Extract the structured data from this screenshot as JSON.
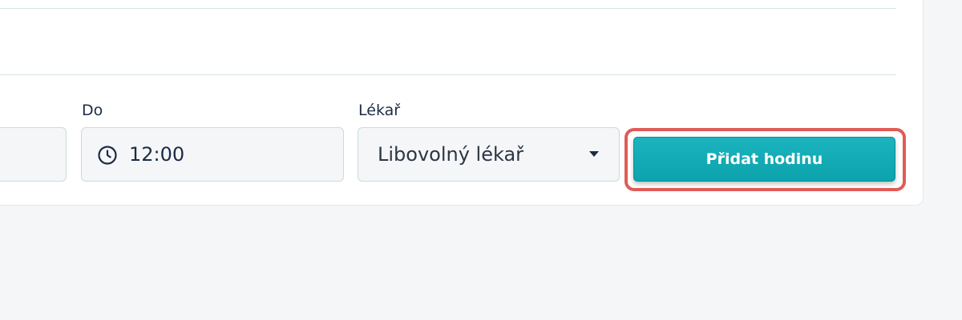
{
  "form": {
    "from_field": {
      "value": ""
    },
    "to_field": {
      "label": "Do",
      "value": "12:00",
      "icon": "clock-icon"
    },
    "doctor_field": {
      "label": "Lékař",
      "selected": "Libovolný lékař",
      "icon": "chevron-down-icon"
    },
    "add_button": {
      "label": "Přidat hodinu"
    }
  },
  "colors": {
    "page_background": "#f5f6f8",
    "button_primary": "#11a9b3",
    "highlight_border": "#e15b56",
    "text_primary": "#1c2b44"
  }
}
